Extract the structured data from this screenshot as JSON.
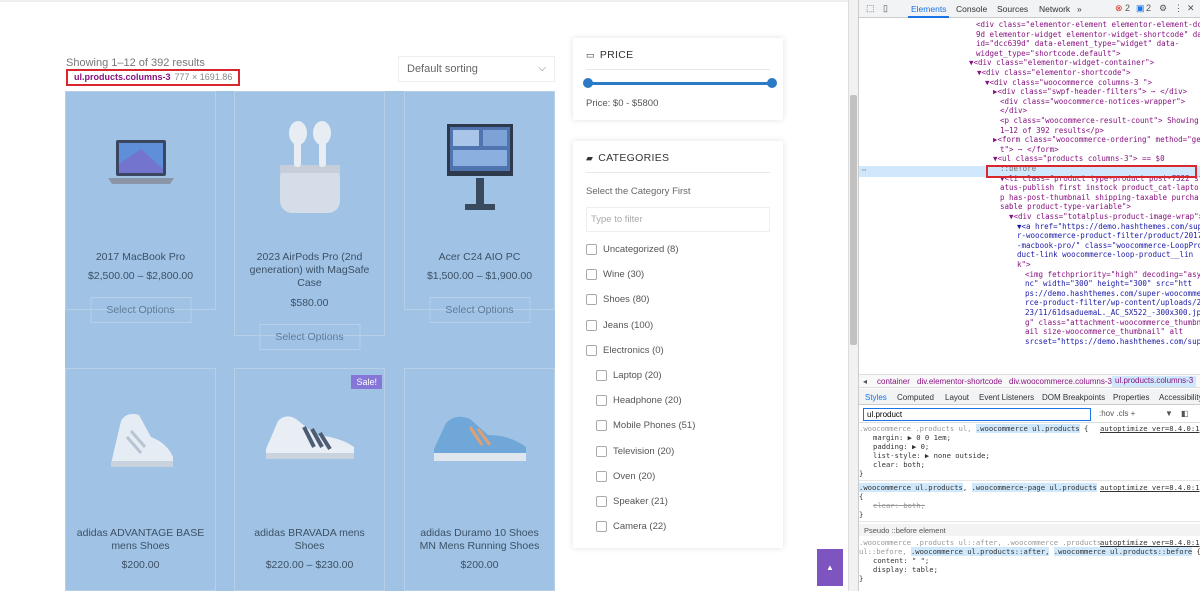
{
  "shop": {
    "results_text": "Showing 1–12 of 392 results",
    "sorting": "Default sorting",
    "tooltip": {
      "selector": "ul.products.columns-3",
      "dims": "777 × 1691.86"
    },
    "products": [
      {
        "title": "2017 MacBook Pro",
        "price": "$2,500.00 – $2,800.00",
        "button": "Select Options",
        "icon": "laptop"
      },
      {
        "title": "2023 AirPods Pro (2nd generation) with MagSafe Case",
        "price": "$580.00",
        "button": "Select Options",
        "icon": "airpods"
      },
      {
        "title": "Acer C24 AIO PC",
        "price": "$1,500.00 – $1,900.00",
        "button": "Select Options",
        "icon": "monitor"
      },
      {
        "title": "adidas ADVANTAGE BASE mens Shoes",
        "price": "$200.00",
        "button": "",
        "icon": "shoe",
        "sale": ""
      },
      {
        "title": "adidas BRAVADA mens Shoes",
        "price": "$220.00 – $230.00",
        "button": "",
        "icon": "shoe",
        "sale": "Sale!"
      },
      {
        "title": "adidas Duramo 10 Shoes MN Mens Running Shoes",
        "price": "$200.00",
        "button": "",
        "icon": "shoe",
        "sale": ""
      }
    ]
  },
  "price_widget": {
    "title": "PRICE",
    "range_text": "Price: $0 - $5800",
    "icon": "price-tag-icon"
  },
  "categories_widget": {
    "title": "CATEGORIES",
    "hint": "Select the Category First",
    "filter_placeholder": "Type to filter",
    "items": [
      {
        "label": "Uncategorized (8)",
        "level": 0
      },
      {
        "label": "Wine (30)",
        "level": 0
      },
      {
        "label": "Shoes (80)",
        "level": 0
      },
      {
        "label": "Jeans (100)",
        "level": 0
      },
      {
        "label": "Electronics (0)",
        "level": 0
      },
      {
        "label": "Laptop (20)",
        "level": 1
      },
      {
        "label": "Headphone (20)",
        "level": 1
      },
      {
        "label": "Mobile Phones (51)",
        "level": 1
      },
      {
        "label": "Television (20)",
        "level": 1
      },
      {
        "label": "Oven (20)",
        "level": 1
      },
      {
        "label": "Speaker (21)",
        "level": 1
      },
      {
        "label": "Camera (22)",
        "level": 1
      }
    ]
  },
  "devtools": {
    "tabs": [
      "Elements",
      "Console",
      "Sources",
      "Network",
      "»"
    ],
    "errors": "2",
    "messages": "2",
    "elements_lines": [
      "<div class=\"elementor-element elementor-element-dcc63",
      "9d elementor-widget elementor-widget-shortcode\" data-",
      "id=\"dcc639d\" data-element_type=\"widget\" data-",
      "widget_type=\"shortcode.default\">",
      "▼<div class=\"elementor-widget-container\">",
      "▼<div class=\"elementor-shortcode\">",
      "▼<div class=\"woocommerce columns-3 \">",
      "▶<div class=\"swpf-header-filters\"> ⋯ </div>",
      "<div class=\"woocommerce-notices-wrapper\">",
      "</div>",
      "<p class=\"woocommerce-result-count\"> Showing",
      "1–12 of 392 results</p>",
      "▶<form class=\"woocommerce-ordering\" method=\"ge",
      "t\"> ⋯ </form>",
      "▼<ul class=\"products columns-3\"> == $0",
      "::before",
      "▼<li class=\"product type-product post-7322 st",
      "atus-publish first instock product_cat-lapto",
      "p has-post-thumbnail shipping-taxable purcha",
      "sable product-type-variable\">",
      "▼<div class=\"totalplus-product-image-wrap\">",
      "▼<a href=\"https://demo.hashthemes.com/supe",
      "r-woocommerce-product-filter/product/2017",
      "-macbook-pro/\" class=\"woocommerce-LoopPro",
      "duct-link woocommerce-loop-product__lin",
      "k\">",
      "<img fetchpriority=\"high\" decoding=\"asy",
      "nc\" width=\"300\" height=\"300\" src=\"htt",
      "ps://demo.hashthemes.com/super-woocomme",
      "rce-product-filter/wp-content/uploads/20",
      "23/11/61dsaduemaL._AC_SX522_-300x300.jp",
      "g\" class=\"attachment-woocommerce_thumbn",
      "ail size-woocommerce_thumbnail\" alt",
      "srcset=\"https://demo.hashthemes.com/sup"
    ],
    "breadcrumbs": [
      "◂",
      "container",
      "div.elementor-shortcode",
      "div.woocommerce.columns-3",
      "ul.products.columns-3"
    ],
    "sub_tabs": [
      "Styles",
      "Computed",
      "Layout",
      "Event Listeners",
      "DOM Breakpoints",
      "Properties",
      "Accessibility"
    ],
    "filter_value": "ul.product",
    "filter_tools": ":hov  .cls  +",
    "css_source": "autoptimize_ver=8.4.0:1",
    "rule1": {
      "selector_a": ".woocommerce .products ul,",
      "selector_b": ".woocommerce ul.products",
      "brace": "{",
      "decls": [
        "margin: ▶ 0 0 1em;",
        "padding: ▶ 0;",
        "list-style: ▶ none outside;",
        "clear: both;"
      ]
    },
    "rule2": {
      "selector_a": ".woocommerce ul.products",
      "selector_b": ".woocommerce-page ul.products",
      "decl": "clear: both;"
    },
    "pseudo_head": "Pseudo ::before element",
    "rule3": {
      "line1": ".woocommerce .products ul::after, .woocommerce .products",
      "line2_a": "ul::before,",
      "line2_b": ".woocommerce ul.products::after,",
      "line2_c": ".woocommerce ul.products::before",
      "decls": [
        "content: \" \";",
        "display: table;"
      ]
    },
    "open_brace": "{",
    "close_brace": "}"
  }
}
